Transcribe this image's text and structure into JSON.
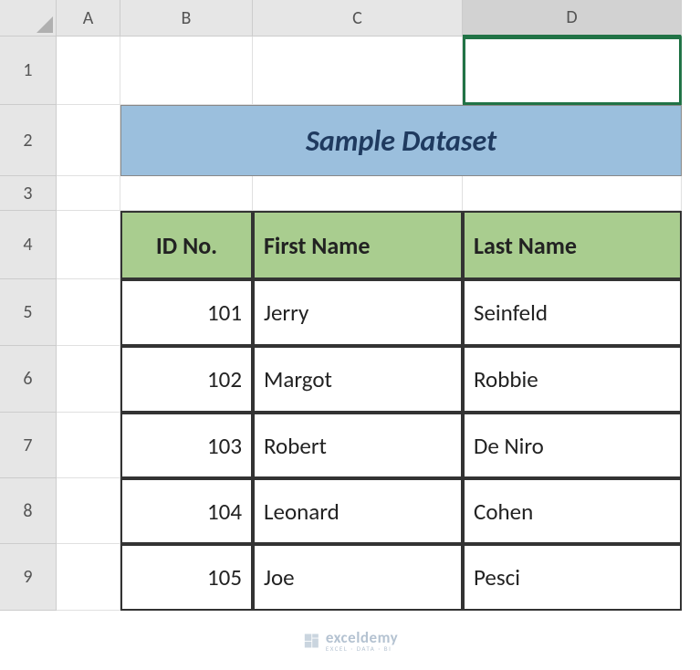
{
  "columns": [
    "A",
    "B",
    "C",
    "D"
  ],
  "rows": [
    "1",
    "2",
    "3",
    "4",
    "5",
    "6",
    "7",
    "8",
    "9"
  ],
  "title": "Sample Dataset",
  "headers": {
    "id": "ID No.",
    "first": "First Name",
    "last": "Last Name"
  },
  "data": [
    {
      "id": "101",
      "first": "Jerry",
      "last": "Seinfeld"
    },
    {
      "id": "102",
      "first": "Margot",
      "last": "Robbie"
    },
    {
      "id": "103",
      "first": "Robert",
      "last": "De Niro"
    },
    {
      "id": "104",
      "first": "Leonard",
      "last": "Cohen"
    },
    {
      "id": "105",
      "first": "Joe",
      "last": "Pesci"
    }
  ],
  "watermark": {
    "main": "exceldemy",
    "sub": "EXCEL · DATA · BI"
  },
  "selected_cell": "D1"
}
